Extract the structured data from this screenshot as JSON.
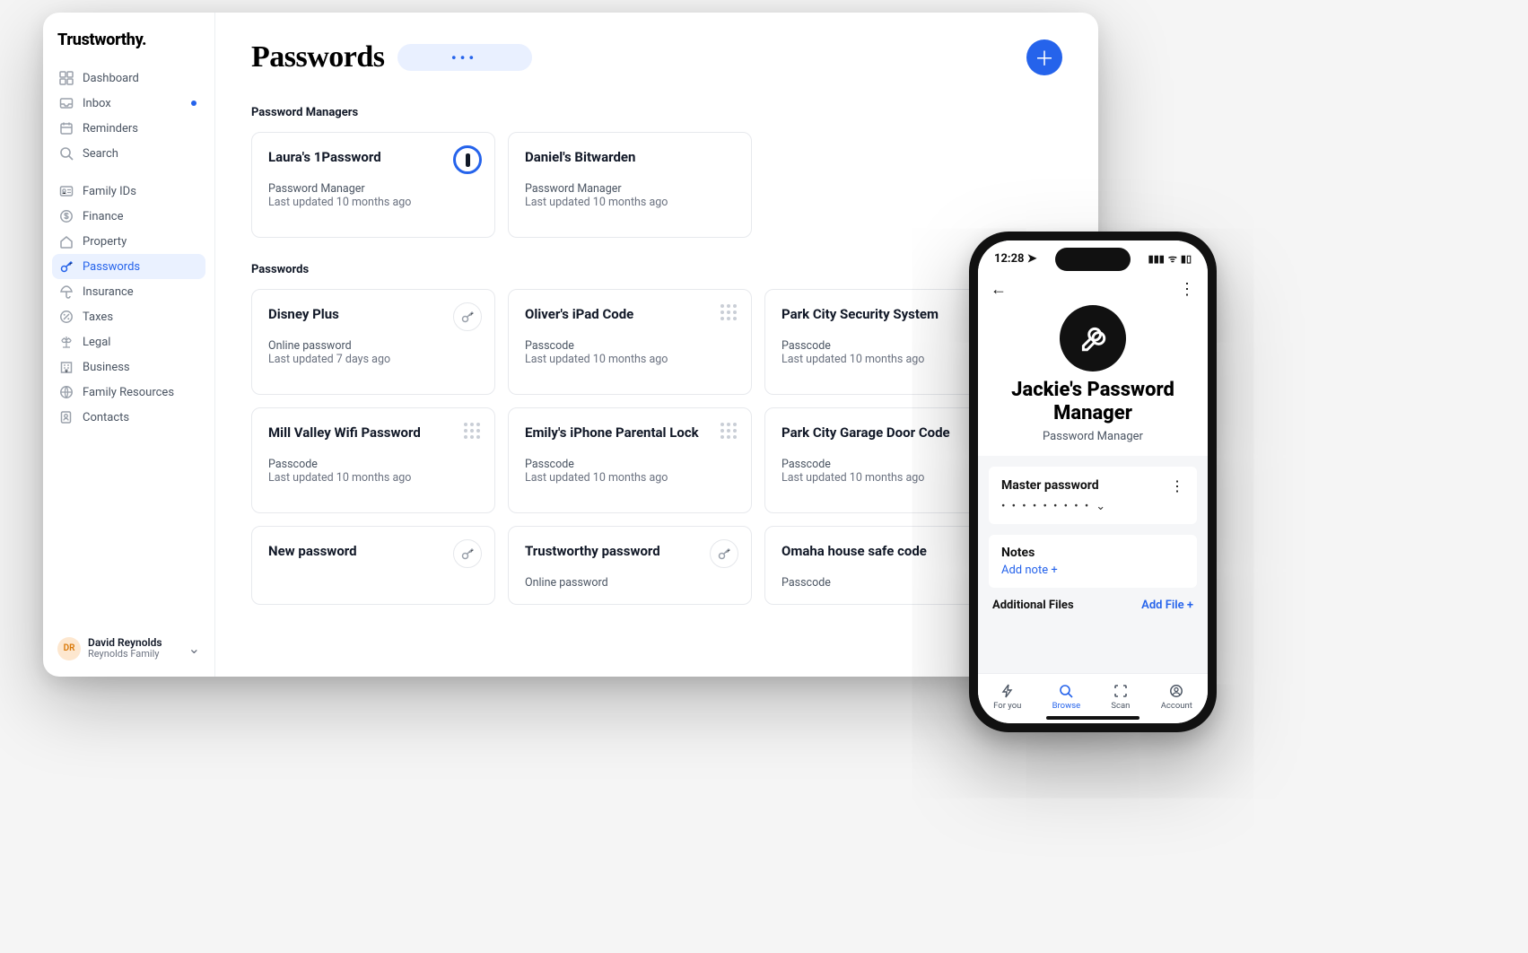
{
  "brand": "Trustworthy.",
  "nav_top": [
    {
      "label": "Dashboard",
      "icon": "dashboard",
      "id": "dashboard"
    },
    {
      "label": "Inbox",
      "icon": "inbox",
      "id": "inbox",
      "dot": true
    },
    {
      "label": "Reminders",
      "icon": "calendar",
      "id": "reminders"
    },
    {
      "label": "Search",
      "icon": "search",
      "id": "search"
    }
  ],
  "nav_main": [
    {
      "label": "Family IDs",
      "icon": "id",
      "id": "family-ids"
    },
    {
      "label": "Finance",
      "icon": "dollar",
      "id": "finance"
    },
    {
      "label": "Property",
      "icon": "home",
      "id": "property"
    },
    {
      "label": "Passwords",
      "icon": "key",
      "id": "passwords",
      "active": true
    },
    {
      "label": "Insurance",
      "icon": "umbrella",
      "id": "insurance"
    },
    {
      "label": "Taxes",
      "icon": "percent",
      "id": "taxes"
    },
    {
      "label": "Legal",
      "icon": "scale",
      "id": "legal"
    },
    {
      "label": "Business",
      "icon": "building",
      "id": "business"
    },
    {
      "label": "Family Resources",
      "icon": "globe",
      "id": "family-resources"
    },
    {
      "label": "Contacts",
      "icon": "contacts",
      "id": "contacts"
    }
  ],
  "user": {
    "initials": "DR",
    "name": "David Reynolds",
    "family": "Reynolds Family"
  },
  "page": {
    "title": "Passwords"
  },
  "sections": {
    "managers": {
      "label": "Password Managers",
      "items": [
        {
          "title": "Laura's 1Password",
          "type": "Password Manager",
          "updated": "Last updated 10 months ago",
          "icon": "onepassword"
        },
        {
          "title": "Daniel's Bitwarden",
          "type": "Password Manager",
          "updated": "Last updated 10 months ago"
        }
      ]
    },
    "passwords": {
      "label": "Passwords",
      "items": [
        {
          "title": "Disney Plus",
          "type": "Online password",
          "updated": "Last updated 7 days ago",
          "icon": "key"
        },
        {
          "title": "Oliver's iPad Code",
          "type": "Passcode",
          "updated": "Last updated 10 months ago",
          "icon": "grip"
        },
        {
          "title": "Park City Security System",
          "type": "Passcode",
          "updated": "Last updated 10 months ago"
        },
        {
          "title": "Mill Valley Wifi Password",
          "type": "Passcode",
          "updated": "Last updated 10 months ago",
          "icon": "grip"
        },
        {
          "title": "Emily's iPhone Parental Lock",
          "type": "Passcode",
          "updated": "Last updated 10 months ago",
          "icon": "grip"
        },
        {
          "title": "Park City Garage Door Code",
          "type": "Passcode",
          "updated": "Last updated 10 months ago"
        },
        {
          "title": "New password",
          "type": "",
          "updated": "",
          "icon": "key"
        },
        {
          "title": "Trustworthy password",
          "type": "Online password",
          "updated": "",
          "icon": "key"
        },
        {
          "title": "Omaha house safe code",
          "type": "Passcode",
          "updated": ""
        }
      ]
    }
  },
  "phone": {
    "time": "12:28",
    "title": "Jackie's Password Manager",
    "subtitle": "Password Manager",
    "master_label": "Master password",
    "master_value": "• • • • • • • • •",
    "notes_label": "Notes",
    "add_note": "Add note +",
    "files_label": "Additional Files",
    "add_file": "Add File +",
    "tabs": [
      {
        "label": "For you",
        "icon": "bolt"
      },
      {
        "label": "Browse",
        "icon": "search",
        "active": true
      },
      {
        "label": "Scan",
        "icon": "scan"
      },
      {
        "label": "Account",
        "icon": "user"
      }
    ]
  }
}
